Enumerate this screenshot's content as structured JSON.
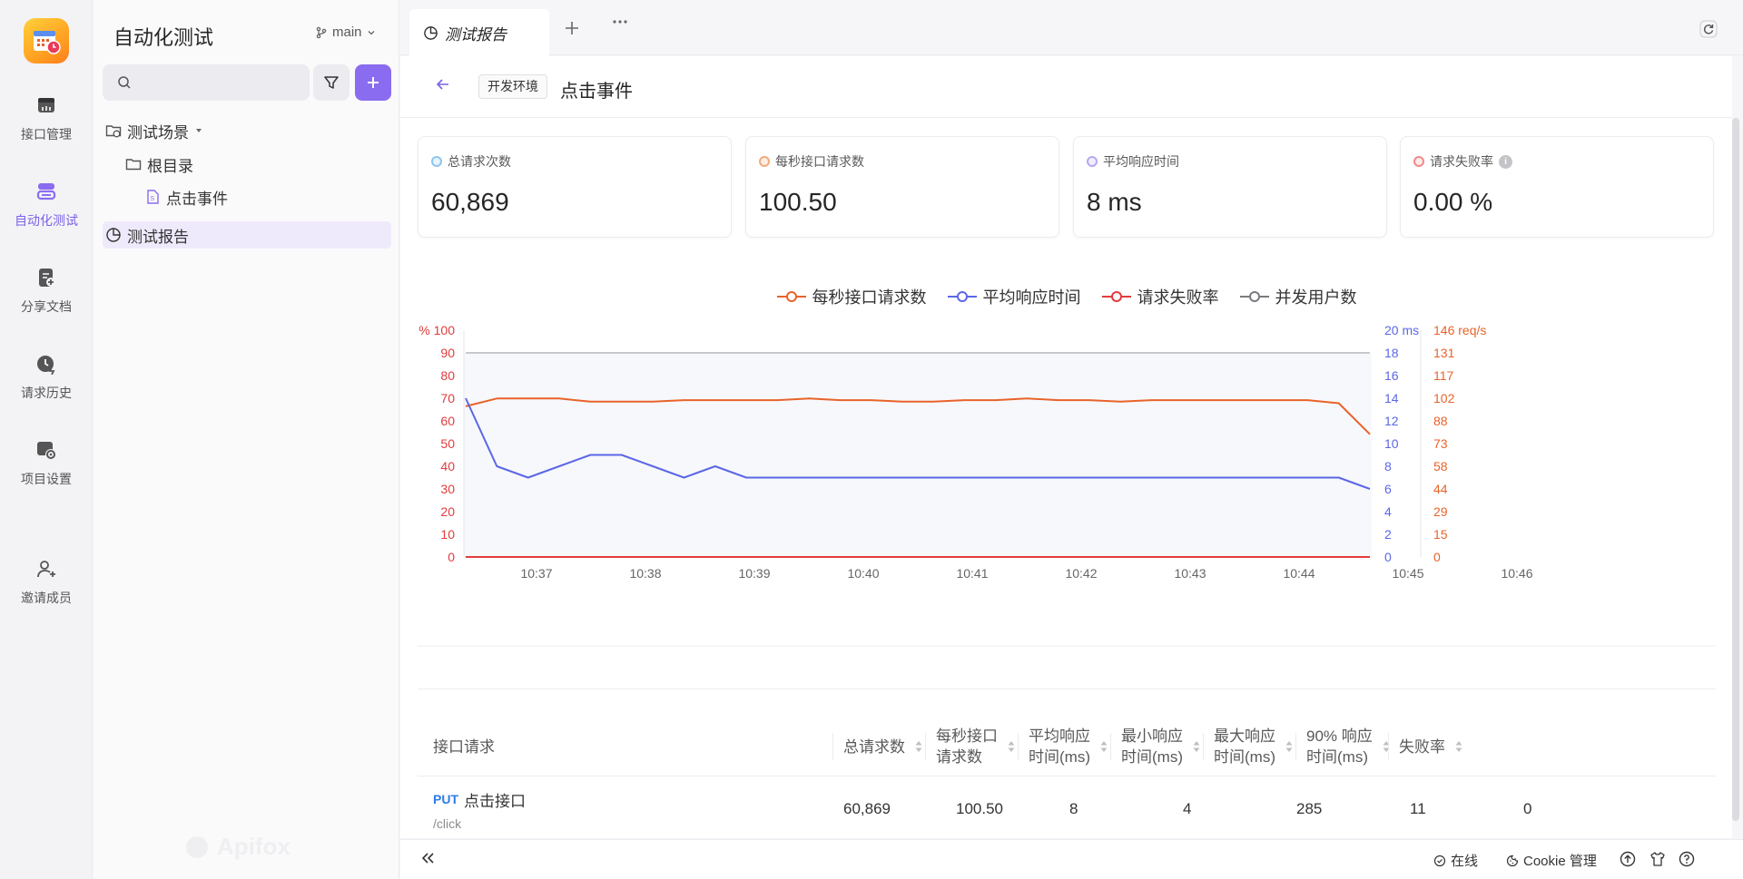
{
  "rail": {
    "items": [
      {
        "label": "接口管理",
        "icon": "api-icon"
      },
      {
        "label": "自动化测试",
        "icon": "automation-icon"
      },
      {
        "label": "分享文档",
        "icon": "share-doc-icon"
      },
      {
        "label": "请求历史",
        "icon": "history-icon"
      },
      {
        "label": "项目设置",
        "icon": "settings-icon"
      },
      {
        "label": "邀请成员",
        "icon": "invite-user-icon"
      }
    ],
    "active_index": 1
  },
  "tree_panel": {
    "project_title": "自动化测试",
    "branch": "main",
    "search_placeholder": "",
    "tree": [
      {
        "label": "测试场景",
        "level": 0
      },
      {
        "label": "根目录",
        "level": 1
      },
      {
        "label": "点击事件",
        "level": 2
      },
      {
        "label": "测试报告",
        "level": 0
      }
    ],
    "watermark": "Apifox"
  },
  "tabs": {
    "active_label": "测试报告"
  },
  "breadcrumb": {
    "env": "开发环境",
    "title": "点击事件"
  },
  "stats": [
    {
      "label": "总请求次数",
      "value": "60,869",
      "color": "#8ec5f0"
    },
    {
      "label": "每秒接口请求数",
      "value": "100.50",
      "color": "#f4a97a"
    },
    {
      "label": "平均响应时间",
      "value": "8 ms",
      "color": "#b7a7f0"
    },
    {
      "label": "请求失败率",
      "value": "0.00 %",
      "color": "#f08a8a"
    }
  ],
  "legend": [
    {
      "label": "每秒接口请求数",
      "color": "#e8632a"
    },
    {
      "label": "平均响应时间",
      "color": "#5b67e6"
    },
    {
      "label": "请求失败率",
      "color": "#e23c3c"
    },
    {
      "label": "并发用户数",
      "color": "#7a7a80"
    }
  ],
  "chart_data": {
    "type": "line",
    "x_labels": [
      "10:37",
      "10:38",
      "10:39",
      "10:40",
      "10:41",
      "10:42",
      "10:43",
      "10:44",
      "10:45",
      "10:46"
    ],
    "left_axis": {
      "title": "%",
      "ticks": [
        "100",
        "90",
        "80",
        "70",
        "60",
        "50",
        "40",
        "30",
        "20",
        "10",
        "0"
      ],
      "color": "#e23c3c"
    },
    "right_axis_1": {
      "unit": "ms",
      "ticks": [
        "20",
        "18",
        "16",
        "14",
        "12",
        "10",
        "8",
        "6",
        "4",
        "2",
        "0"
      ],
      "color": "#5b67e6"
    },
    "right_axis_2": {
      "unit": "req/s",
      "ticks": [
        "146",
        "131",
        "117",
        "102",
        "88",
        "73",
        "58",
        "44",
        "29",
        "15",
        "0"
      ],
      "color": "#e8632a"
    },
    "series": [
      {
        "name": "每秒接口请求数",
        "axis": "right_axis_2",
        "color": "#e8632a",
        "values": [
          97,
          102,
          102,
          102,
          100,
          100,
          100,
          101,
          101,
          101,
          101,
          102,
          101,
          101,
          100,
          100,
          101,
          101,
          102,
          101,
          101,
          100,
          101,
          101,
          101,
          101,
          101,
          101,
          99,
          79
        ]
      },
      {
        "name": "平均响应时间",
        "axis": "right_axis_1",
        "color": "#5b67e6",
        "values": [
          14,
          8,
          7,
          8,
          9,
          9,
          8,
          7,
          8,
          7,
          7,
          7,
          7,
          7,
          7,
          7,
          7,
          7,
          7,
          7,
          7,
          7,
          7,
          7,
          7,
          7,
          7,
          7,
          7,
          6
        ]
      },
      {
        "name": "请求失败率",
        "axis": "left_axis",
        "color": "#e23c3c",
        "values": [
          0,
          0,
          0,
          0,
          0,
          0,
          0,
          0,
          0,
          0,
          0,
          0,
          0,
          0,
          0,
          0,
          0,
          0,
          0,
          0,
          0,
          0,
          0,
          0,
          0,
          0,
          0,
          0,
          0,
          0
        ]
      },
      {
        "name": "并发用户数",
        "axis": "left_axis",
        "color": "#c8c8cc",
        "values": [
          90,
          90,
          90,
          90,
          90,
          90,
          90,
          90,
          90,
          90,
          90,
          90,
          90,
          90,
          90,
          90,
          90,
          90,
          90,
          90,
          90,
          90,
          90,
          90,
          90,
          90,
          90,
          90,
          90,
          90
        ]
      }
    ]
  },
  "table": {
    "columns": [
      {
        "label": "接口请求",
        "sortable": false
      },
      {
        "label": "总请求数",
        "sortable": true
      },
      {
        "label": "每秒接口\n请求数",
        "sortable": true
      },
      {
        "label": "平均响应\n时间(ms)",
        "sortable": true
      },
      {
        "label": "最小响应\n时间(ms)",
        "sortable": true
      },
      {
        "label": "最大响应\n时间(ms)",
        "sortable": true
      },
      {
        "label": "90% 响应\n时间(ms)",
        "sortable": true
      },
      {
        "label": "失败率",
        "sortable": true
      }
    ],
    "rows": [
      {
        "method": "PUT",
        "name": "点击接口",
        "path": "/click",
        "total": "60,869",
        "rps": "100.50",
        "avg": "8",
        "min": "4",
        "max": "285",
        "p90": "11",
        "fail": "0"
      }
    ]
  },
  "statusbar": {
    "online": "在线",
    "cookie": "Cookie 管理"
  }
}
